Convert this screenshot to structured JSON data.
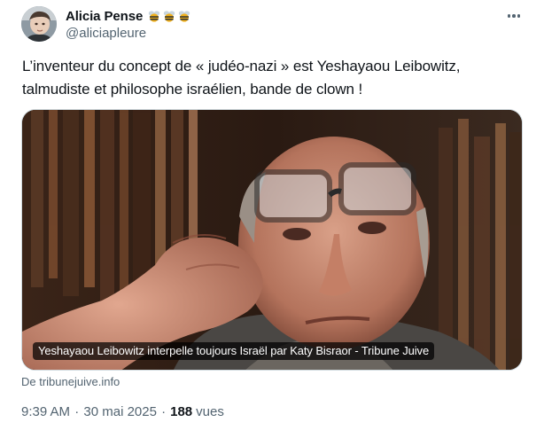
{
  "author": {
    "display_name": "Alicia Pense",
    "handle": "@aliciapleure",
    "name_emojis": [
      "bee-emoji",
      "bee-emoji",
      "bee-emoji"
    ]
  },
  "tweet": {
    "text": "L’inventeur du concept de « judéo-nazi » est Yeshayaou Leibowitz, talmudiste et philosophe israélien, bande de clown !"
  },
  "media": {
    "caption": "Yeshayaou Leibowitz interpelle toujours Israël par Katy Bisraor - Tribune Juive",
    "source": "De tribunejuive.info"
  },
  "meta": {
    "time": "9:39 AM",
    "separator": "·",
    "date": "30 mai 2025",
    "views_count": "188",
    "views_label": "vues"
  },
  "icons": {
    "more": "more-horizontal-icon"
  },
  "colors": {
    "text_primary": "#0f1419",
    "text_secondary": "#536471",
    "border": "#cfd9de"
  }
}
